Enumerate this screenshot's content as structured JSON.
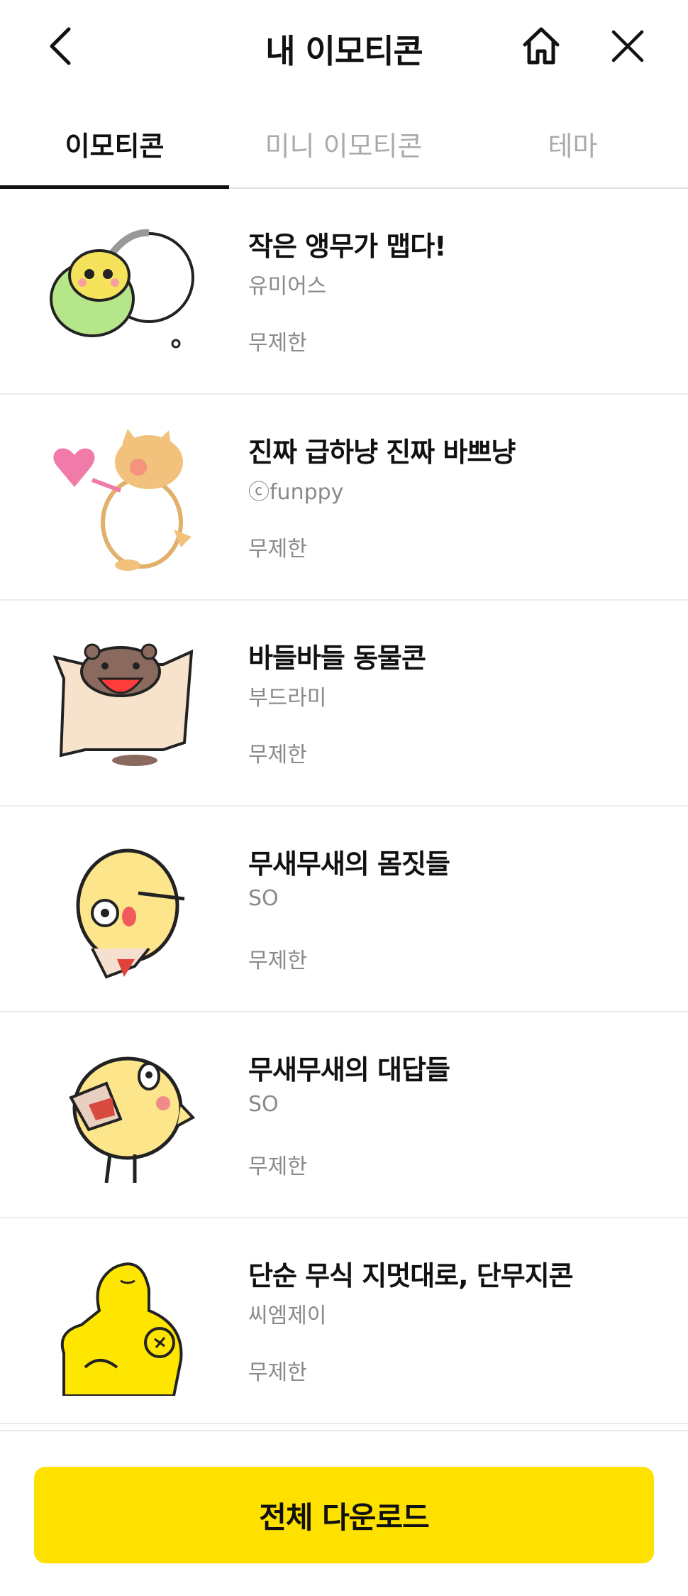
{
  "header": {
    "title": "내 이모티콘",
    "icons": {
      "back": "chevron-left-icon",
      "home": "home-icon",
      "close": "close-icon"
    }
  },
  "tabs": [
    {
      "label": "이모티콘",
      "active": true
    },
    {
      "label": "미니 이모티콘",
      "active": false
    },
    {
      "label": "테마",
      "active": false
    }
  ],
  "items": [
    {
      "name": "작은 앵무가 맵다!",
      "author": "유미어스",
      "period": "무제한",
      "thumb": "parrot-sticker"
    },
    {
      "name": "진짜 급하냥 진짜 바쁘냥",
      "author": "ⓒfunppy",
      "period": "무제한",
      "thumb": "cat-heart-sticker"
    },
    {
      "name": "바들바들 동물콘",
      "author": "부드라미",
      "period": "무제한",
      "thumb": "flying-squirrel-sticker"
    },
    {
      "name": "무새무새의 몸짓들",
      "author": "SO",
      "period": "무제한",
      "thumb": "chick-gesture-sticker"
    },
    {
      "name": "무새무새의 대답들",
      "author": "SO",
      "period": "무제한",
      "thumb": "chick-answer-sticker"
    },
    {
      "name": "단순 무식 지멋대로, 단무지콘",
      "author": "씨엠제이",
      "period": "무제한",
      "thumb": "yellow-character-sticker"
    }
  ],
  "footer": {
    "download_label": "전체 다운로드",
    "accent": "#ffe100"
  }
}
